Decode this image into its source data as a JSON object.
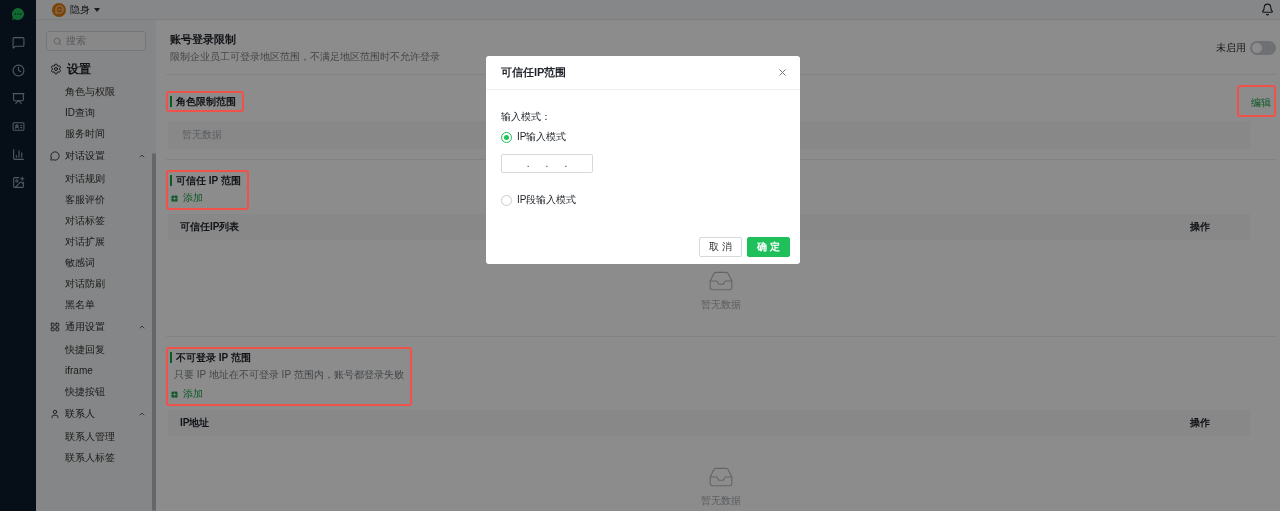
{
  "topbar": {
    "status": "隐身"
  },
  "sidebar": {
    "search": {
      "placeholder": "搜索"
    },
    "groups": [
      {
        "label": "设置",
        "kind": "plain",
        "children": [
          {
            "label": "角色与权限"
          },
          {
            "label": "ID查询"
          },
          {
            "label": "服务时间"
          }
        ]
      },
      {
        "label": "对话设置",
        "kind": "toggle",
        "expanded": true,
        "children": [
          {
            "label": "对话规则"
          },
          {
            "label": "客服评价"
          },
          {
            "label": "对话标签"
          },
          {
            "label": "对话扩展"
          },
          {
            "label": "敏感词"
          },
          {
            "label": "对话防刷"
          },
          {
            "label": "黑名单"
          }
        ]
      },
      {
        "label": "通用设置",
        "kind": "toggle",
        "expanded": true,
        "children": [
          {
            "label": "快捷回复"
          },
          {
            "label": "iframe"
          },
          {
            "label": "快捷按钮"
          }
        ]
      },
      {
        "label": "联系人",
        "kind": "toggle",
        "expanded": true,
        "children": [
          {
            "label": "联系人管理"
          },
          {
            "label": "联系人标签"
          }
        ]
      }
    ]
  },
  "header": {
    "title": "账号登录限制",
    "description": "限制企业员工可登录地区范围，不满足地区范围时不允许登录",
    "toggle": {
      "label": "未启用",
      "on": false
    }
  },
  "sections": [
    {
      "kind": "role",
      "title": "角色限制范围",
      "highlighted": true,
      "action": "编辑",
      "action_highlighted": true,
      "empty_text": "暂无数据"
    },
    {
      "kind": "table",
      "title": "可信任 IP 范围",
      "highlighted": true,
      "add": "添加",
      "columns": [
        "可信任IP列表",
        "操作"
      ],
      "empty_text": "暂无数据"
    },
    {
      "kind": "table",
      "title": "不可登录 IP 范围",
      "highlighted": true,
      "description": "只要 IP 地址在不可登录 IP 范围内，账号都登录失败",
      "add": "添加",
      "columns": [
        "IP地址",
        "操作"
      ],
      "empty_text": "暂无数据"
    }
  ],
  "dialog": {
    "title": "可信任IP范围",
    "label": "输入模式：",
    "options": [
      {
        "label": "IP输入模式",
        "selected": true
      },
      {
        "label": "IP段输入模式",
        "selected": false
      }
    ],
    "ip_separators": [
      ".",
      ".",
      "."
    ],
    "buttons": [
      {
        "label": "取 消",
        "kind": "secondary"
      },
      {
        "label": "确 定",
        "kind": "primary"
      }
    ]
  }
}
